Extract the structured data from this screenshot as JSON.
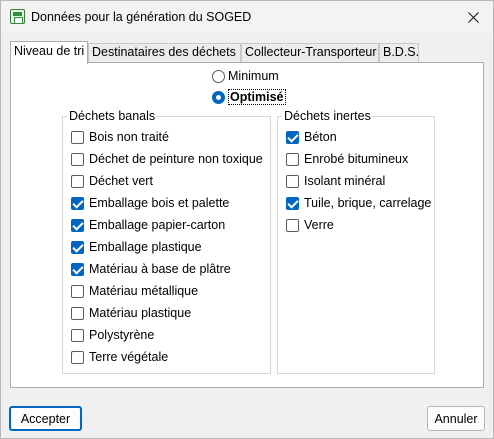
{
  "window": {
    "title": "Données pour la génération du SOGED",
    "app_icon": "spreadsheet-app-icon",
    "close_icon": "close-icon"
  },
  "tabs": [
    {
      "label": "Niveau de tri",
      "active": true
    },
    {
      "label": "Destinataires des déchets",
      "active": false
    },
    {
      "label": "Collecteur-Transporteur",
      "active": false
    },
    {
      "label": "B.D.S.",
      "active": false
    }
  ],
  "sort_level": {
    "options": [
      {
        "label": "Minimum",
        "selected": false
      },
      {
        "label": "Optimisé",
        "selected": true
      }
    ]
  },
  "banal_waste": {
    "legend": "Déchets banals",
    "items": [
      {
        "label": "Bois non traité",
        "checked": false
      },
      {
        "label": "Déchet de peinture non toxique",
        "checked": false
      },
      {
        "label": "Déchet vert",
        "checked": false
      },
      {
        "label": "Emballage bois et palette",
        "checked": true
      },
      {
        "label": "Emballage papier-carton",
        "checked": true
      },
      {
        "label": "Emballage plastique",
        "checked": true
      },
      {
        "label": "Matériau à base de plâtre",
        "checked": true
      },
      {
        "label": "Matériau métallique",
        "checked": false
      },
      {
        "label": "Matériau plastique",
        "checked": false
      },
      {
        "label": "Polystyrène",
        "checked": false
      },
      {
        "label": "Terre végétale",
        "checked": false
      }
    ]
  },
  "inert_waste": {
    "legend": "Déchets inertes",
    "items": [
      {
        "label": "Béton",
        "checked": true
      },
      {
        "label": "Enrobé bitumineux",
        "checked": false
      },
      {
        "label": "Isolant minéral",
        "checked": false
      },
      {
        "label": "Tuile, brique, carrelage",
        "checked": true
      },
      {
        "label": "Verre",
        "checked": false
      }
    ]
  },
  "footer": {
    "accept_label": "Accepter",
    "cancel_label": "Annuler"
  },
  "colors": {
    "accent": "#0067c0",
    "window_bg": "#f0f0f0",
    "panel_bg": "#ffffff"
  }
}
